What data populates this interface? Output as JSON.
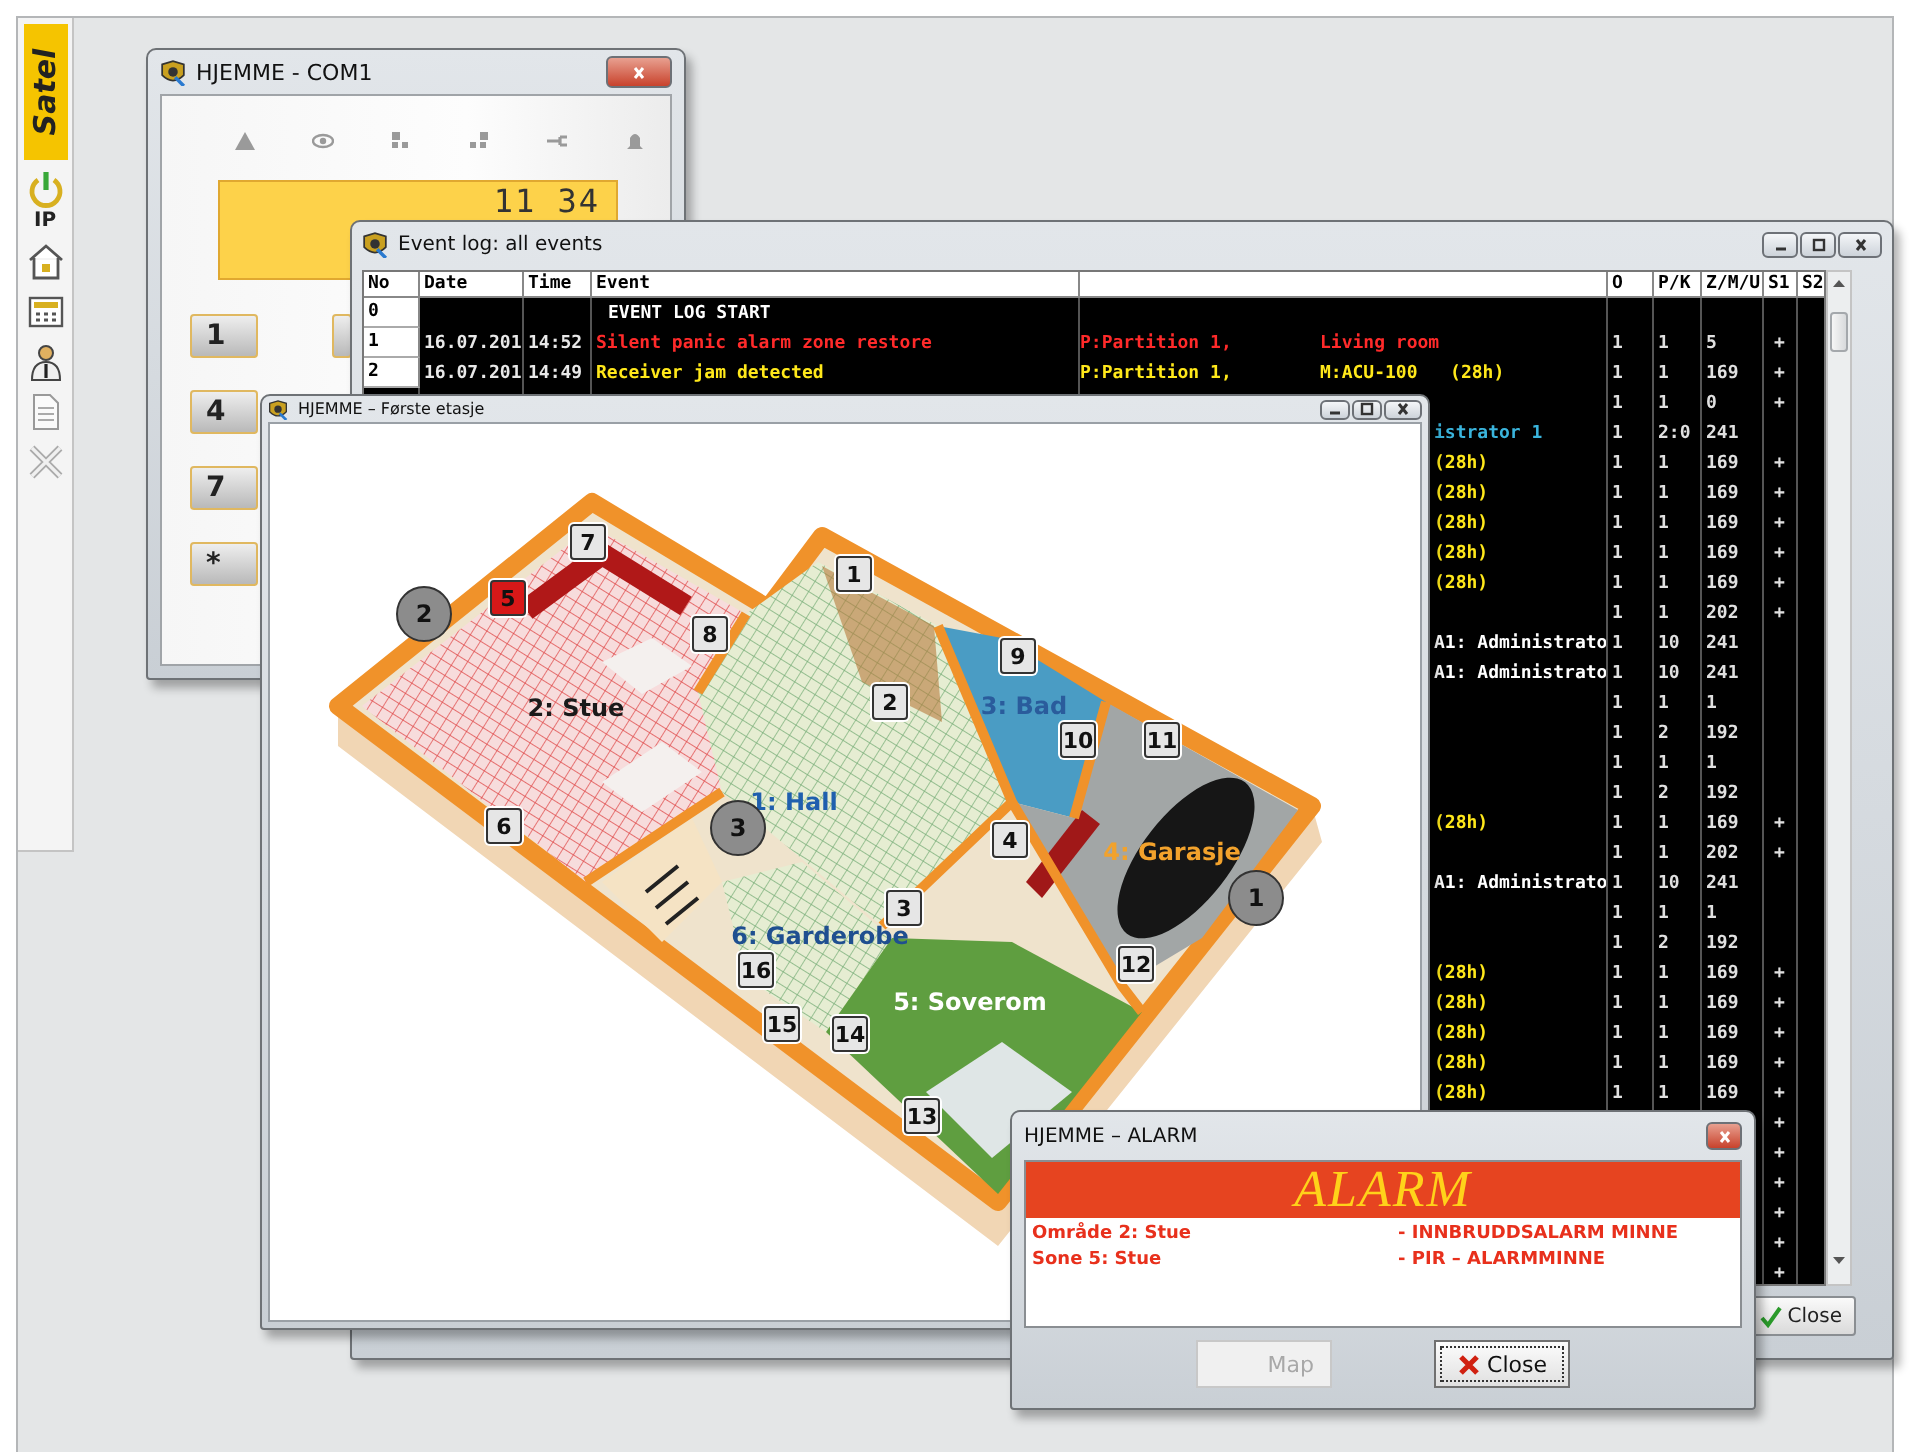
{
  "sidebar": {
    "logo": "Satel",
    "ip_label": "IP"
  },
  "keypad_window": {
    "title": "HJEMME - COM1",
    "display": "11 34",
    "keys": [
      "1",
      "4",
      "7",
      "*"
    ]
  },
  "event_log": {
    "title": "Event log: all events",
    "columns": [
      "No",
      "Date",
      "Time",
      "Event",
      "O",
      "P/K",
      "Z/M/U",
      "S1",
      "S2"
    ],
    "rows": [
      {
        "kind": "full",
        "no": "0",
        "event": "EVENT LOG START",
        "color": "#ffffff"
      },
      {
        "kind": "full",
        "no": "1",
        "date": "16.07.201",
        "time": "14:52",
        "event": "Silent panic alarm zone restore",
        "partition": "P:Partition 1,",
        "source": "Living room",
        "o": "1",
        "pk": "1",
        "zmu": "5",
        "s1": "+",
        "color": "#ff2a2a"
      },
      {
        "kind": "full",
        "no": "2",
        "date": "16.07.201",
        "time": "14:49",
        "event": "Receiver jam detected",
        "partition": "P:Partition 1,",
        "source": "M:ACU-100   (28h)",
        "o": "1",
        "pk": "1",
        "zmu": "169",
        "s1": "+",
        "color": "#ffe81a"
      },
      {
        "kind": "partial",
        "o": "1",
        "pk": "1",
        "zmu": "0",
        "s1": "+"
      },
      {
        "kind": "partial",
        "source": "istrator 1",
        "color": "#3ab4dc",
        "o": "1",
        "pk": "2:0",
        "zmu": "241"
      },
      {
        "kind": "partial",
        "source": "(28h)",
        "color": "#ffe81a",
        "o": "1",
        "pk": "1",
        "zmu": "169",
        "s1": "+"
      },
      {
        "kind": "partial",
        "source": "(28h)",
        "color": "#ffe81a",
        "o": "1",
        "pk": "1",
        "zmu": "169",
        "s1": "+"
      },
      {
        "kind": "partial",
        "source": "(28h)",
        "color": "#ffe81a",
        "o": "1",
        "pk": "1",
        "zmu": "169",
        "s1": "+"
      },
      {
        "kind": "partial",
        "source": "(28h)",
        "color": "#ffe81a",
        "o": "1",
        "pk": "1",
        "zmu": "169",
        "s1": "+"
      },
      {
        "kind": "partial",
        "source": "(28h)",
        "color": "#ffe81a",
        "o": "1",
        "pk": "1",
        "zmu": "169",
        "s1": "+"
      },
      {
        "kind": "partial",
        "o": "1",
        "pk": "1",
        "zmu": "202",
        "s1": "+"
      },
      {
        "kind": "partial",
        "source": "A1: Administrato",
        "color": "#ffffff",
        "o": "1",
        "pk": "10",
        "zmu": "241"
      },
      {
        "kind": "partial",
        "source": "A1: Administrato",
        "color": "#ffffff",
        "o": "1",
        "pk": "10",
        "zmu": "241"
      },
      {
        "kind": "partial",
        "o": "1",
        "pk": "1",
        "zmu": "1"
      },
      {
        "kind": "partial",
        "o": "1",
        "pk": "2",
        "zmu": "192"
      },
      {
        "kind": "partial",
        "o": "1",
        "pk": "1",
        "zmu": "1"
      },
      {
        "kind": "partial",
        "o": "1",
        "pk": "2",
        "zmu": "192"
      },
      {
        "kind": "partial",
        "source": "(28h)",
        "color": "#ffe81a",
        "o": "1",
        "pk": "1",
        "zmu": "169",
        "s1": "+"
      },
      {
        "kind": "partial",
        "o": "1",
        "pk": "1",
        "zmu": "202",
        "s1": "+"
      },
      {
        "kind": "partial",
        "source": "A1: Administrato",
        "color": "#ffffff",
        "o": "1",
        "pk": "10",
        "zmu": "241"
      },
      {
        "kind": "partial",
        "o": "1",
        "pk": "1",
        "zmu": "1"
      },
      {
        "kind": "partial",
        "o": "1",
        "pk": "2",
        "zmu": "192"
      },
      {
        "kind": "partial",
        "source": "(28h)",
        "color": "#ffe81a",
        "o": "1",
        "pk": "1",
        "zmu": "169",
        "s1": "+"
      },
      {
        "kind": "partial",
        "source": "(28h)",
        "color": "#ffe81a",
        "o": "1",
        "pk": "1",
        "zmu": "169",
        "s1": "+"
      },
      {
        "kind": "partial",
        "source": "(28h)",
        "color": "#ffe81a",
        "o": "1",
        "pk": "1",
        "zmu": "169",
        "s1": "+"
      },
      {
        "kind": "partial",
        "source": "(28h)",
        "color": "#ffe81a",
        "o": "1",
        "pk": "1",
        "zmu": "169",
        "s1": "+"
      },
      {
        "kind": "partial",
        "source": "(28h)",
        "color": "#ffe81a",
        "o": "1",
        "pk": "1",
        "zmu": "169",
        "s1": "+"
      },
      {
        "kind": "partial",
        "s1": "+"
      },
      {
        "kind": "partial",
        "s1": "+"
      },
      {
        "kind": "partial",
        "s1": "+"
      },
      {
        "kind": "partial",
        "s1": "+"
      },
      {
        "kind": "partial",
        "s1": "+"
      },
      {
        "kind": "partial",
        "s1": "+"
      }
    ],
    "close_button": "Close"
  },
  "floor_plan": {
    "title": "HJEMME – Første etasje",
    "rooms": [
      {
        "label": "2: Stue",
        "color": "#1a1a1a"
      },
      {
        "label": "1: Hall",
        "color": "#1f5fae"
      },
      {
        "label": "3: Bad",
        "color": "#2a5c9c"
      },
      {
        "label": "4: Garasje",
        "color": "#f2a22c"
      },
      {
        "label": "6: Garderobe",
        "color": "#1f4f90"
      },
      {
        "label": "5: Soverom",
        "color": "#ffffff"
      }
    ],
    "detectors": [
      {
        "label": "1",
        "alarm": false
      },
      {
        "label": "2",
        "alarm": false
      },
      {
        "label": "3",
        "alarm": false
      },
      {
        "label": "4",
        "alarm": false
      },
      {
        "label": "5",
        "alarm": true
      },
      {
        "label": "6",
        "alarm": false
      },
      {
        "label": "7",
        "alarm": false
      },
      {
        "label": "8",
        "alarm": false
      },
      {
        "label": "9",
        "alarm": false
      },
      {
        "label": "10",
        "alarm": false
      },
      {
        "label": "11",
        "alarm": false
      },
      {
        "label": "12",
        "alarm": false
      },
      {
        "label": "13",
        "alarm": false
      },
      {
        "label": "14",
        "alarm": false
      },
      {
        "label": "15",
        "alarm": false
      },
      {
        "label": "16",
        "alarm": false
      }
    ],
    "modules": [
      {
        "label": "1"
      },
      {
        "label": "2"
      },
      {
        "label": "3"
      }
    ]
  },
  "alarm_window": {
    "title": "HJEMME – ALARM",
    "banner": "ALARM",
    "entries": [
      {
        "source": "Område 2: Stue",
        "message": "- INNBRUDDSALARM MINNE"
      },
      {
        "source": "Sone 5: Stue",
        "message": "- PIR – ALARMMINNE"
      }
    ],
    "buttons": [
      {
        "kind": "map",
        "label": "Map",
        "disabled": true,
        "focused": false
      },
      {
        "kind": "close",
        "label": "Close",
        "disabled": false,
        "focused": true
      }
    ]
  }
}
